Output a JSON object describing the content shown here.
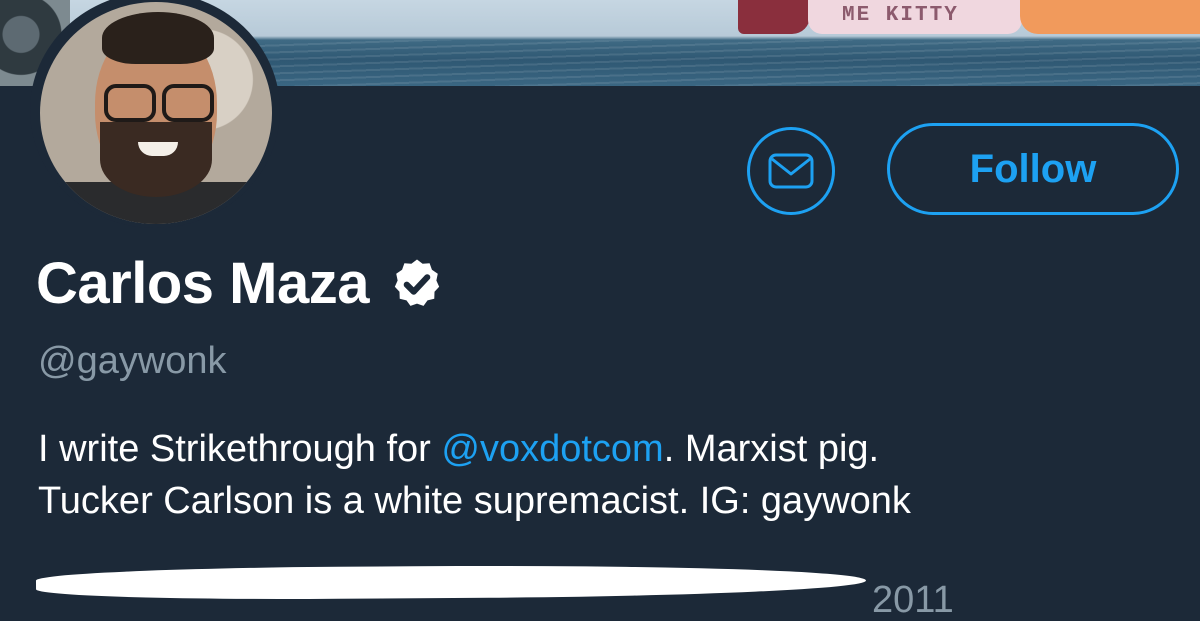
{
  "banner": {
    "shirt_text": "ME KITTY"
  },
  "profile": {
    "display_name": "Carlos Maza",
    "handle": "@gaywonk",
    "bio": {
      "part1": "I write Strikethrough for ",
      "mention": "@voxdotcom",
      "part2": ". Marxist pig.",
      "line2": "Tucker Carlson is a white supremacist. IG: gaywonk"
    },
    "joined_fragment": "2011"
  },
  "actions": {
    "follow_label": "Follow"
  },
  "icons": {
    "message": "envelope-icon",
    "verified": "verified-badge-icon"
  },
  "colors": {
    "accent": "#1da1f2",
    "background": "#1c2938",
    "muted": "#8899a6",
    "text": "#ffffff"
  }
}
